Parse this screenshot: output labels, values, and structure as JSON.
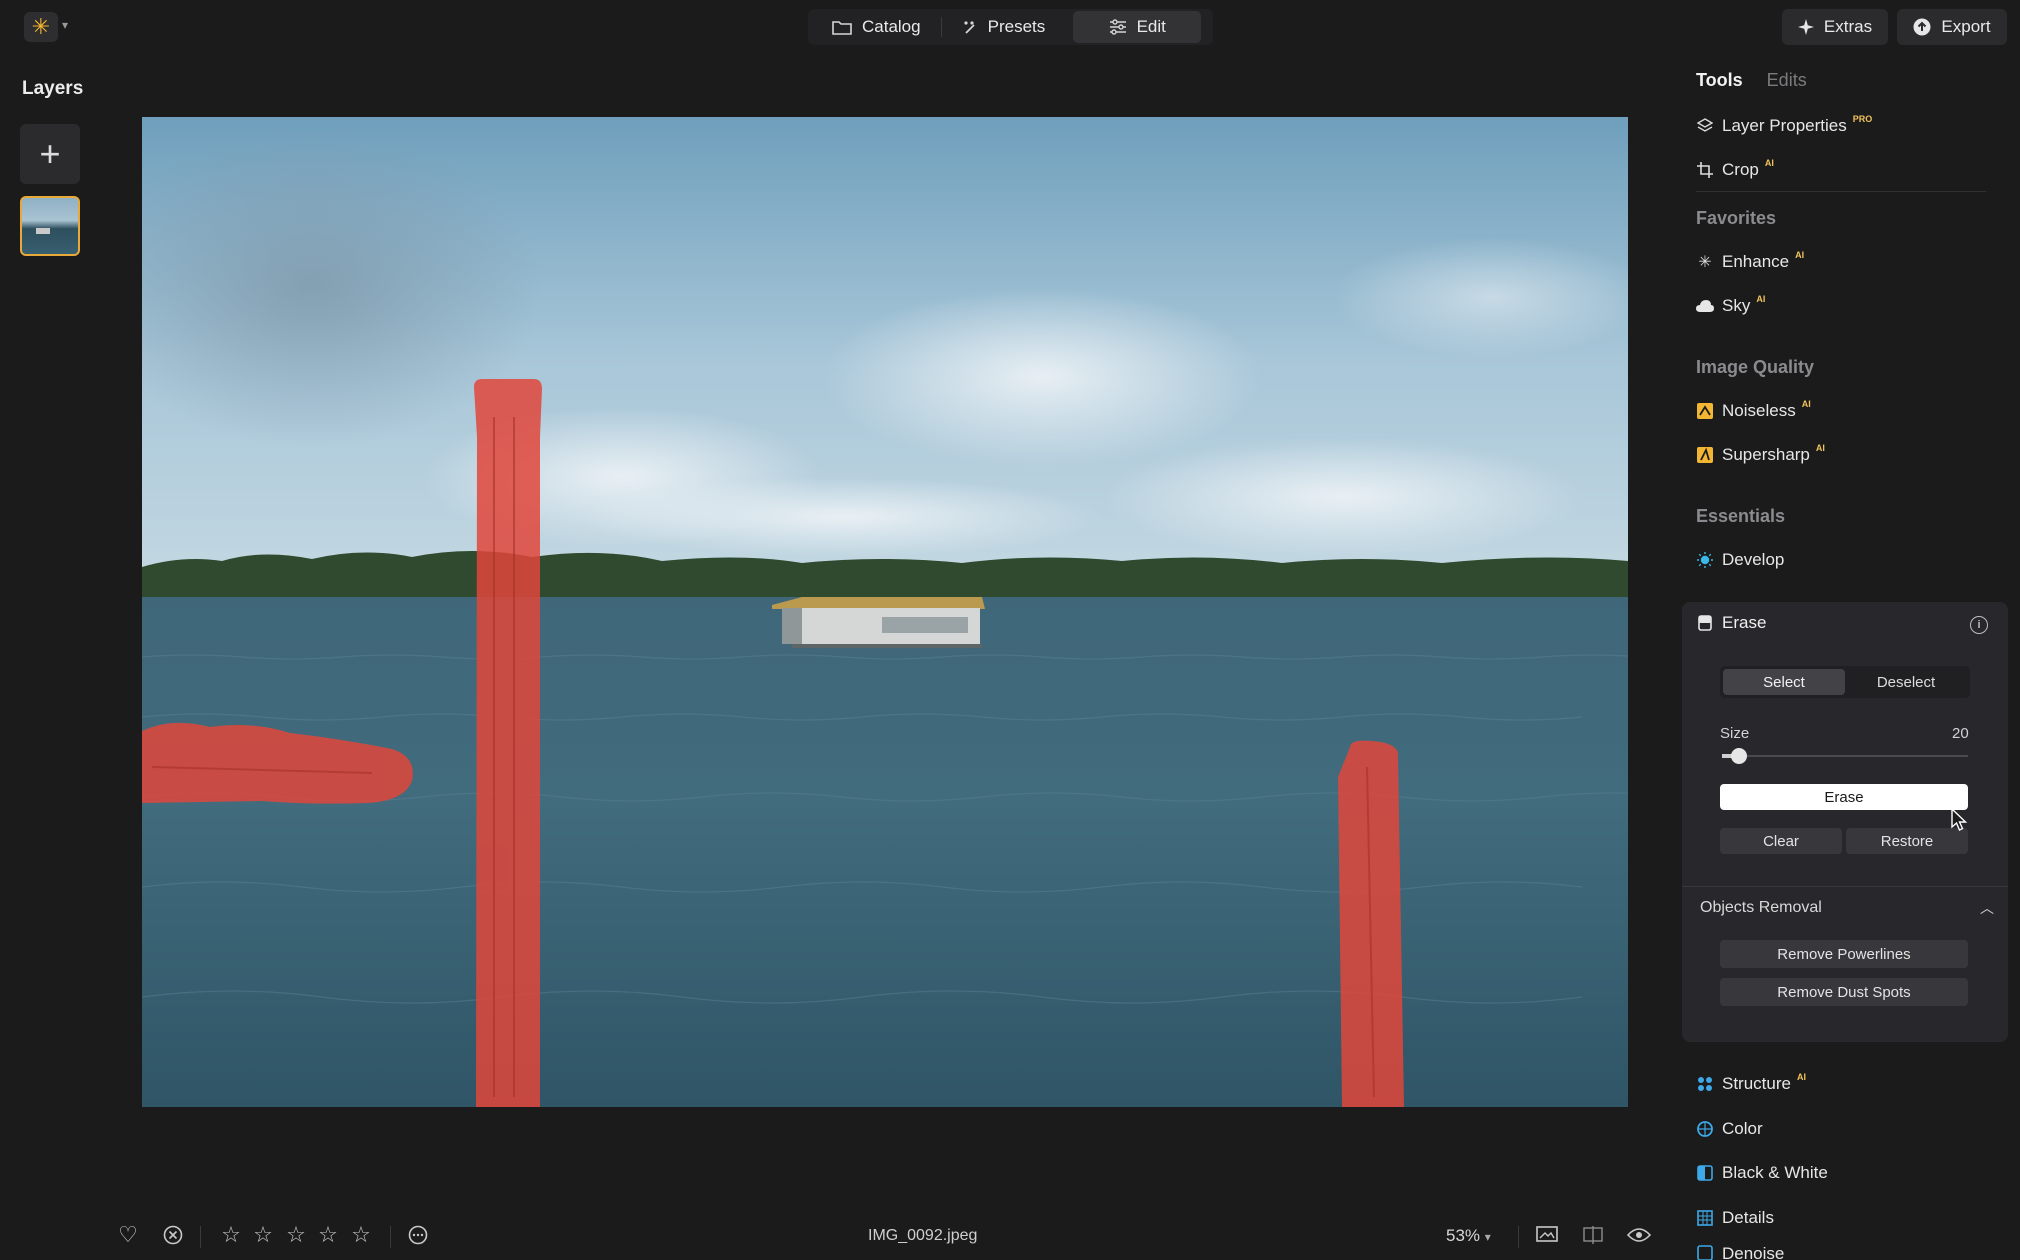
{
  "topbar": {
    "modes": [
      {
        "label": "Catalog",
        "icon": "folder-icon"
      },
      {
        "label": "Presets",
        "icon": "presets-icon"
      },
      {
        "label": "Edit",
        "icon": "sliders-icon",
        "active": true
      }
    ],
    "extras_label": "Extras",
    "export_label": "Export"
  },
  "layers": {
    "title": "Layers"
  },
  "bottombar": {
    "filename": "IMG_0092.jpeg",
    "zoom": "53%",
    "stars": 0,
    "stars_total": 5
  },
  "rpanel": {
    "tabs": {
      "tools": "Tools",
      "edits": "Edits"
    },
    "items": {
      "layer_properties": {
        "label": "Layer Properties",
        "badge": "PRO"
      },
      "crop": {
        "label": "Crop",
        "badge": "AI"
      },
      "favorites": "Favorites",
      "enhance": {
        "label": "Enhance",
        "badge": "AI"
      },
      "sky": {
        "label": "Sky",
        "badge": "AI"
      },
      "image_quality": "Image Quality",
      "noiseless": {
        "label": "Noiseless",
        "badge": "AI"
      },
      "supersharp": {
        "label": "Supersharp",
        "badge": "AI"
      },
      "essentials": "Essentials",
      "develop": {
        "label": "Develop"
      },
      "structure": {
        "label": "Structure",
        "badge": "AI"
      },
      "color": {
        "label": "Color"
      },
      "black_white": {
        "label": "Black & White"
      },
      "details": {
        "label": "Details"
      },
      "denoise": {
        "label": "Denoise"
      }
    },
    "erase": {
      "title": "Erase",
      "select_label": "Select",
      "deselect_label": "Deselect",
      "size_label": "Size",
      "size_value": "20",
      "size_fraction": 0.07,
      "erase_label": "Erase",
      "clear_label": "Clear",
      "restore_label": "Restore",
      "objects_removal_label": "Objects Removal",
      "remove_powerlines_label": "Remove Powerlines",
      "remove_dust_label": "Remove Dust Spots"
    }
  },
  "colors": {
    "accent": "#f6b52c",
    "mask": "#e0463b",
    "panel": "#28282c"
  }
}
